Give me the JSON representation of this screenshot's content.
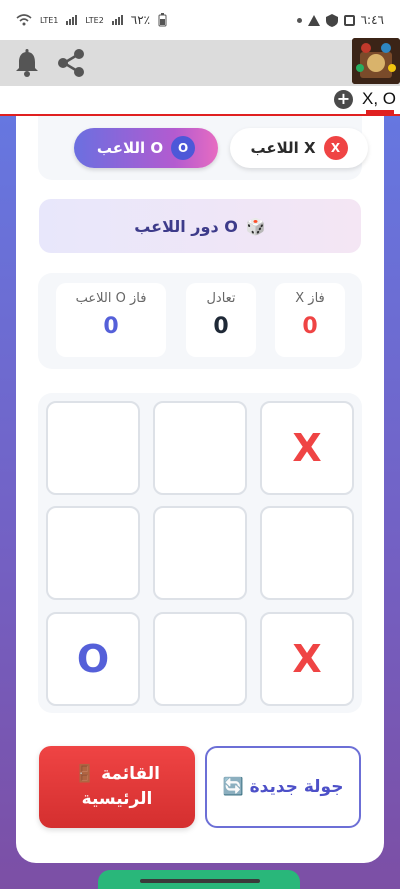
{
  "status_bar": {
    "time": "٦:٤٦",
    "left_info": "٦٢٪",
    "lte1": "LTE1",
    "lte2": "LTE2"
  },
  "ad_bar": {
    "close_label": "X, O"
  },
  "players": {
    "player_o": {
      "label": "اللاعب O",
      "badge": "O"
    },
    "player_x": {
      "label": "اللاعب X",
      "badge": "X"
    }
  },
  "turn": {
    "emoji": "🎲",
    "text": "دور اللاعب O"
  },
  "scores": {
    "x_wins": {
      "label": "X فاز",
      "value": "0"
    },
    "ties": {
      "label": "تعادل",
      "value": "0"
    },
    "o_wins": {
      "label": "اللاعب O فاز",
      "value": "0"
    }
  },
  "board": [
    "X",
    "",
    "",
    "",
    "",
    "",
    "X",
    "",
    "O"
  ],
  "buttons": {
    "new_round": "🔄 جولة جديدة",
    "main_menu": "🚪 القائمة الرئيسية"
  },
  "colors": {
    "accent": "#6b6fe0",
    "x_color": "#ef4444",
    "o_color": "#5560d9",
    "frame_top": "#6677e0",
    "frame_bottom": "#7c4fa5"
  }
}
